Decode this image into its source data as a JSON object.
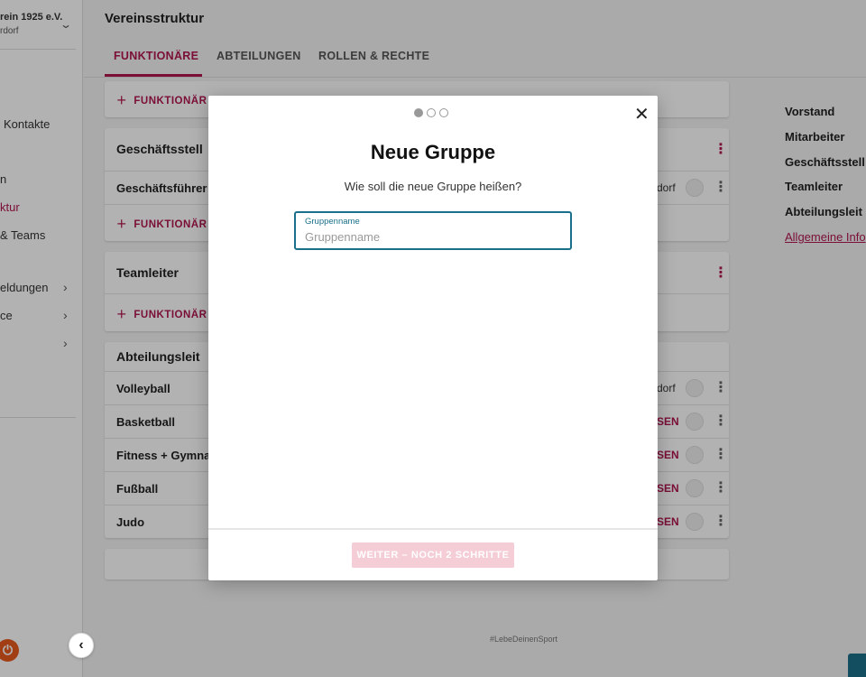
{
  "sidebar": {
    "club_name": "rein 1925 e.V.",
    "club_sub": "rdorf",
    "items": [
      {
        "label": "Kontakte"
      },
      {
        "label": "n"
      },
      {
        "label": "ktur"
      },
      {
        "label": "& Teams"
      },
      {
        "label": "eldungen"
      },
      {
        "label": "ce"
      }
    ],
    "logo_glyph": "⏻"
  },
  "header": {
    "title": "Vereinsstruktur",
    "tabs": [
      {
        "label": "FUNKTIONÄRE",
        "active": true
      },
      {
        "label": "ABTEILUNGEN",
        "active": false
      },
      {
        "label": "ROLLEN & RECHTE",
        "active": false
      }
    ]
  },
  "cards": {
    "add_label": "FUNKTIONÄR",
    "geschaeftsstelle": {
      "title": "Geschäftsstell",
      "row": "Geschäftsführer",
      "right": "dorf"
    },
    "teamleiter": {
      "title": "Teamleiter"
    },
    "abteilungsleiter": {
      "title": "Abteilungsleit",
      "rows": [
        {
          "name": "Volleyball",
          "right": "dorf"
        },
        {
          "name": "Basketball",
          "right": "SEN"
        },
        {
          "name": "Fitness + Gymnas",
          "right": "SEN"
        },
        {
          "name": "Fußball",
          "right": "SEN"
        },
        {
          "name": "Judo",
          "right": "SEN"
        }
      ]
    }
  },
  "right_panel": {
    "items": [
      "Vorstand",
      "Mitarbeiter",
      "Geschäftsstell",
      "Teamleiter",
      "Abteilungsleit"
    ],
    "link": "Allgemeine Info"
  },
  "footer_tag": "#LebeDeinenSport",
  "modal": {
    "steps_total": 3,
    "step_current": 1,
    "title": "Neue Gruppe",
    "subtitle": "Wie soll die neue Gruppe heißen?",
    "field_label": "Gruppenname",
    "field_placeholder": "Gruppenname",
    "field_value": "",
    "next_label": "WEITER – NOCH 2 SCHRITTE",
    "close_glyph": "✕"
  },
  "colors": {
    "accent": "#b0164e",
    "field_border": "#1a6f8a",
    "button_disabled": "#f5cdd6"
  }
}
